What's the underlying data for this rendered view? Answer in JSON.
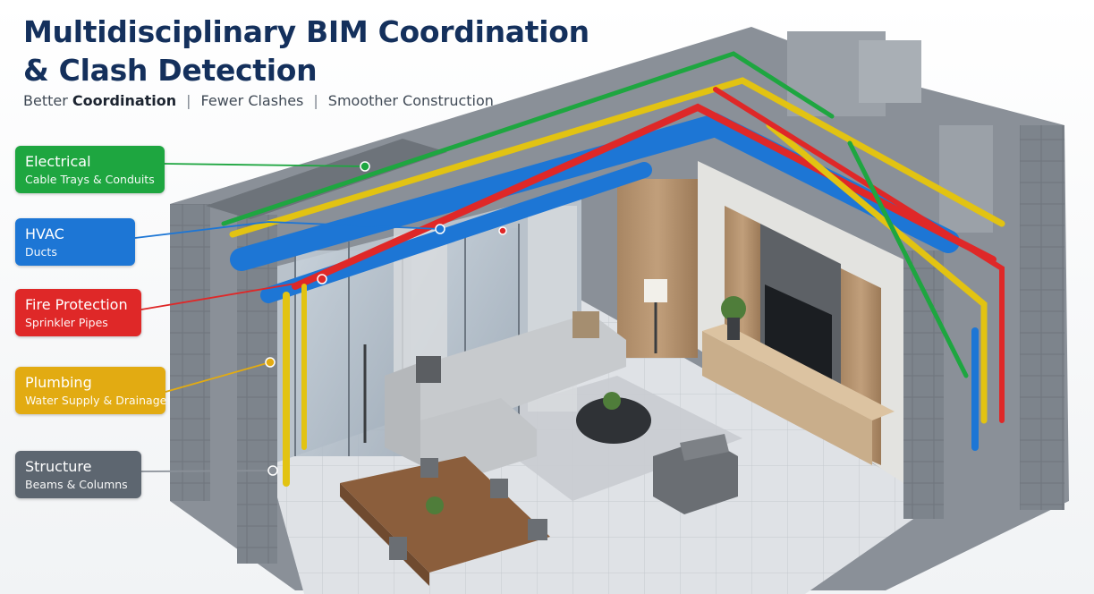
{
  "header": {
    "title_line1": "Multidisciplinary BIM Coordination",
    "title_line2": "& Clash Detection",
    "tagline": {
      "item1_prefix": "Better",
      "item1_emphasis": "Coordination",
      "separator": "|",
      "item2": "Fewer Clashes",
      "item3": "Smoother Construction"
    }
  },
  "legend": {
    "electrical": {
      "title": "Electrical",
      "subtitle": "Cable Trays & Conduits",
      "color": "#1ea640"
    },
    "hvac": {
      "title": "HVAC",
      "subtitle": "Ducts",
      "color": "#1d76d5"
    },
    "fire": {
      "title": "Fire Protection",
      "subtitle": "Sprinkler Pipes",
      "color": "#df2828"
    },
    "plumbing": {
      "title": "Plumbing",
      "subtitle": "Water Supply & Drainage",
      "color": "#e2ab12"
    },
    "structure": {
      "title": "Structure",
      "subtitle": "Beams & Columns",
      "color": "#5d6670"
    }
  },
  "icons": [
    "sofa-icon",
    "tv-icon",
    "dining-table-icon",
    "floor-lamp-icon",
    "plant-icon"
  ]
}
